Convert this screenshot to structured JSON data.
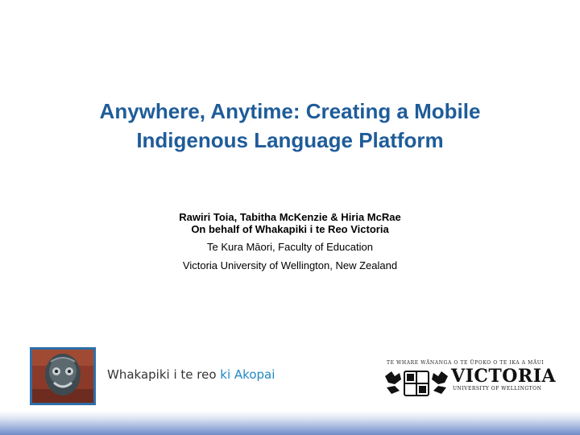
{
  "title": {
    "line1": "Anywhere, Anytime: Creating a Mobile",
    "line2": "Indigenous Language Platform"
  },
  "authors": {
    "names": "Rawiri Toia, Tabitha McKenzie & Hiria McRae",
    "behalf": "On behalf of Whakapiki i te Reo Victoria",
    "school": "Te Kura Māori, Faculty of Education",
    "university": "Victoria University of Wellington, New Zealand"
  },
  "logos": {
    "left_text_main": "Whakapiki i te reo",
    "left_text_accent": "ki Akopai",
    "right_tagline": "TE WHARE WĀNANGA O TE ŪPOKO O TE IKA A MĀUI",
    "right_wordmark": "VICTORIA",
    "right_subword": "UNIVERSITY OF WELLINGTON"
  },
  "colors": {
    "title": "#1f5c99",
    "accent": "#1f88c4",
    "footer": "#6f8cc8"
  }
}
